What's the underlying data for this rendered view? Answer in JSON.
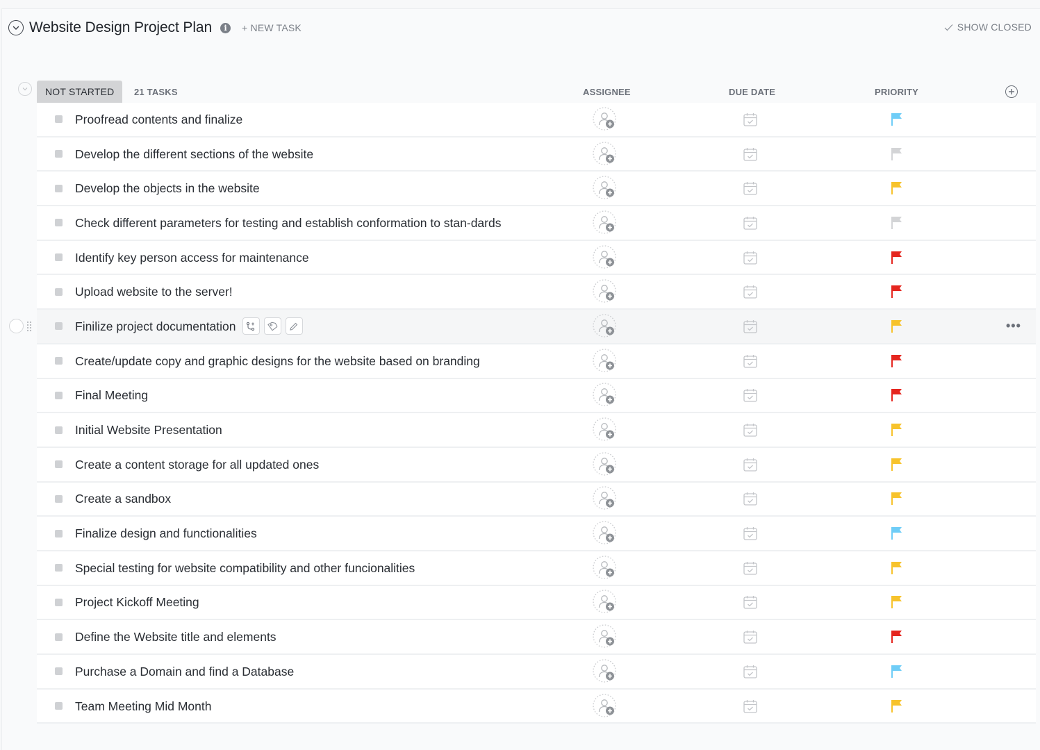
{
  "header": {
    "title": "Website Design Project Plan",
    "new_task_label": "+ NEW TASK",
    "show_closed_label": "SHOW CLOSED"
  },
  "group": {
    "status": "NOT STARTED",
    "task_count": "21 TASKS",
    "columns": {
      "assignee": "ASSIGNEE",
      "due_date": "DUE DATE",
      "priority": "PRIORITY"
    }
  },
  "priority_colors": {
    "urgent": "#e5261f",
    "high": "#f7c32c",
    "normal": "#6fcdf7",
    "low": "#d3d4d6"
  },
  "tasks": [
    {
      "name": "Proofread contents and finalize",
      "priority": "normal"
    },
    {
      "name": "Develop the different sections of the website",
      "priority": "low"
    },
    {
      "name": "Develop the objects in the website",
      "priority": "high"
    },
    {
      "name": "Check different parameters for testing and establish conformation to stan-dards",
      "priority": "low"
    },
    {
      "name": "Identify key person access for maintenance",
      "priority": "urgent"
    },
    {
      "name": "Upload website to the server!",
      "priority": "urgent"
    },
    {
      "name": "Finilize project documentation",
      "priority": "high",
      "hovered": true
    },
    {
      "name": "Create/update copy and graphic designs for the website based on branding",
      "priority": "urgent"
    },
    {
      "name": "Final Meeting",
      "priority": "urgent"
    },
    {
      "name": "Initial Website Presentation",
      "priority": "high"
    },
    {
      "name": "Create a content storage for all updated ones",
      "priority": "high"
    },
    {
      "name": "Create a sandbox",
      "priority": "high"
    },
    {
      "name": "Finalize design and functionalities",
      "priority": "normal"
    },
    {
      "name": "Special testing for website compatibility and other funcionalities",
      "priority": "high"
    },
    {
      "name": "Project Kickoff Meeting",
      "priority": "high"
    },
    {
      "name": "Define the Website title and elements",
      "priority": "urgent"
    },
    {
      "name": "Purchase a Domain and find a Database",
      "priority": "normal"
    },
    {
      "name": "Team Meeting Mid Month",
      "priority": "high"
    }
  ],
  "row_actions": {
    "more_label": "•••"
  }
}
